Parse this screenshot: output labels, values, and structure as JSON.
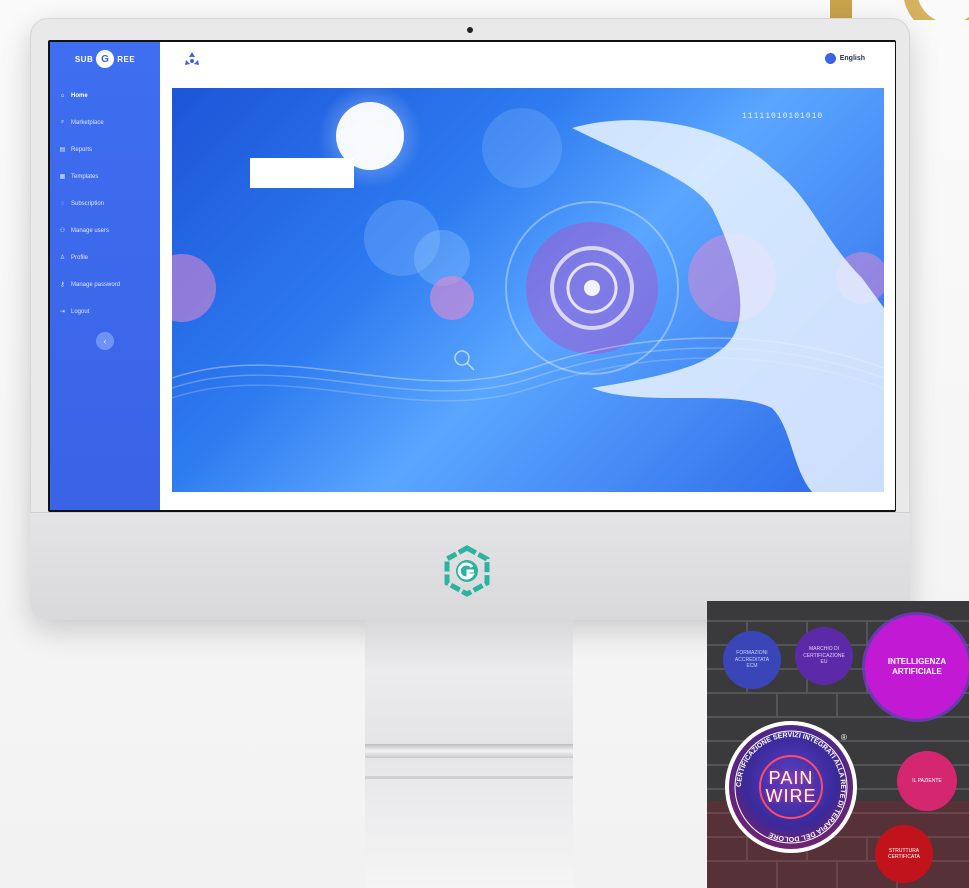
{
  "sidebar": {
    "brand": "SUB",
    "brand_suffix": "REE",
    "items": [
      {
        "icon": "home-icon",
        "glyph": "⌂",
        "label": "Home"
      },
      {
        "icon": "marketplace-icon",
        "glyph": "⌕",
        "label": "Marketplace"
      },
      {
        "icon": "reports-icon",
        "glyph": "▤",
        "label": "Reports"
      },
      {
        "icon": "templates-icon",
        "glyph": "▦",
        "label": "Templates"
      },
      {
        "icon": "subscription-icon",
        "glyph": "◌",
        "label": "Subscription"
      },
      {
        "icon": "users-icon",
        "glyph": "⚇",
        "label": "Manage users"
      },
      {
        "icon": "profile-icon",
        "glyph": "♙",
        "label": "Profile"
      },
      {
        "icon": "key-icon",
        "glyph": "⚷",
        "label": "Manage password"
      },
      {
        "icon": "logout-icon",
        "glyph": "⇥",
        "label": "Logout"
      }
    ],
    "collapse_glyph": "‹"
  },
  "topbar": {
    "language": "English"
  },
  "hero": {
    "binary_text": "11111010101010"
  },
  "overlay": {
    "circles": {
      "formazioni": "FORMAZIONI ACCREDITATA ECM",
      "marchio": "MARCHIO DI CERTIFICAZIONE EU",
      "intelligenza": "INTELLIGENZA ARTIFICIALE",
      "paziente": "IL PAZIENTE",
      "struttura": "STRUTTURA CERTIFICATA"
    },
    "painwire_line1": "PAIN",
    "painwire_line2": "WIRE",
    "painwire_ring": "CERTIFICAZIONE SERVIZI INTEGRATI ALLA RETE DI TERAPIA DEL DOLORE",
    "registered": "®"
  },
  "colors": {
    "sidebar": "#3a63e6",
    "accent": "#3f6ef0",
    "chin_logo": "#2bb3a0"
  }
}
